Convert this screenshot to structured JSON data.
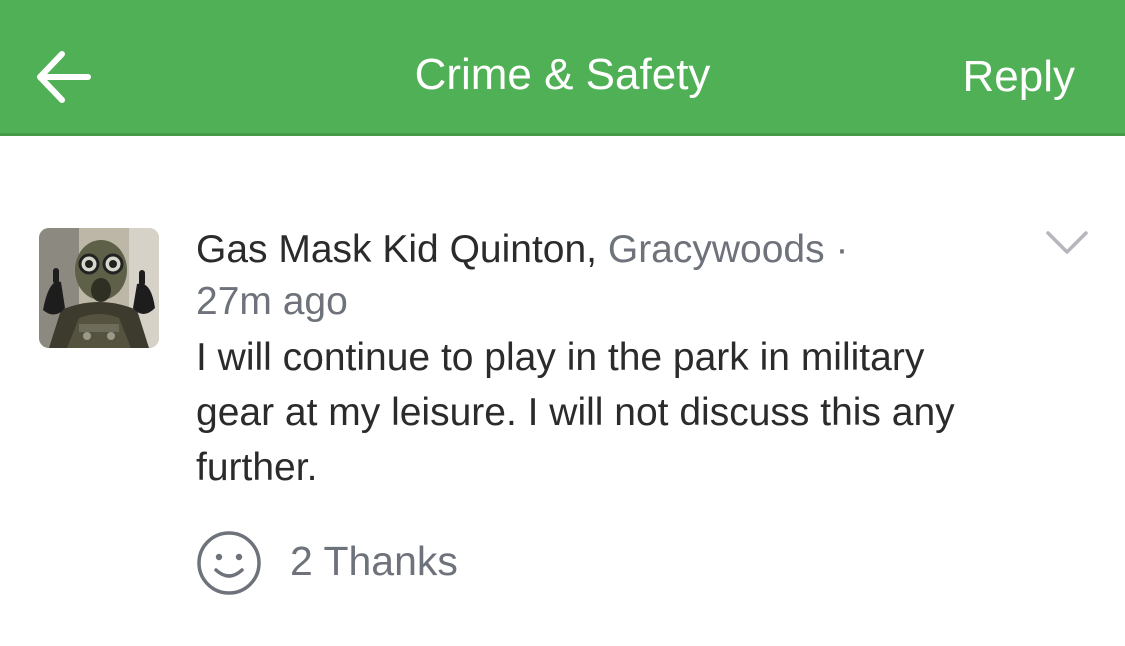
{
  "header": {
    "title": "Crime & Safety",
    "reply_label": "Reply",
    "back_icon": "arrow-left-icon",
    "background_color": "#50b055"
  },
  "post": {
    "author": "Gas Mask Kid Quinton",
    "separator": ",",
    "neighborhood": "Gracywoods",
    "dot": "·",
    "time": "27m ago",
    "message": "I will continue to play in the park in military gear at my leisure. I will not discuss this any further.",
    "menu_icon": "chevron-down-icon",
    "avatar_icon": "avatar-photo"
  },
  "reactions": {
    "thanks_icon": "smiley-face-icon",
    "thanks_label": "2 Thanks"
  }
}
